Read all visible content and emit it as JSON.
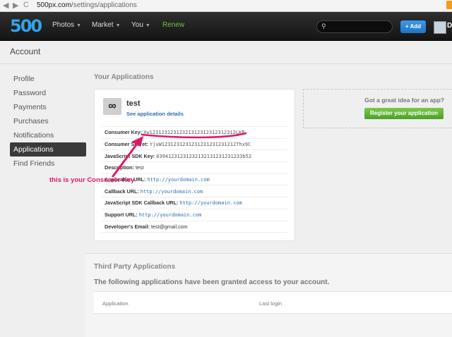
{
  "browser": {
    "url_host": "500px.com",
    "url_path": "/settings/applications",
    "back": "◀",
    "forward": "▶",
    "reload": "C"
  },
  "topnav": {
    "logo": "500",
    "items": [
      {
        "label": "Photos",
        "caret": "▼"
      },
      {
        "label": "Market",
        "caret": "▼"
      },
      {
        "label": "You",
        "caret": "▼"
      }
    ],
    "renew": "Renew",
    "search_placeholder": "",
    "add_label": "+ Add",
    "user_initial": "D"
  },
  "page_title": "Account",
  "sidebar": {
    "items": [
      {
        "label": "Profile"
      },
      {
        "label": "Password"
      },
      {
        "label": "Payments"
      },
      {
        "label": "Purchases"
      },
      {
        "label": "Notifications"
      },
      {
        "label": "Applications",
        "active": true
      },
      {
        "label": "Find Friends"
      }
    ]
  },
  "your_apps": {
    "title": "Your Applications",
    "app": {
      "icon": "∞",
      "name": "test",
      "details_link": "See application details",
      "rows": [
        {
          "label": "Consumer Key:",
          "value": "Xw12312312312321312312312312312LKR",
          "kind": "mono"
        },
        {
          "label": "Consumer Secret:",
          "value": "YjuW1231231231231231231231212Thx9C",
          "kind": "mono"
        },
        {
          "label": "JavaScript SDK Key:",
          "value": "83941231231232132131231231233b52",
          "kind": "mono"
        },
        {
          "label": "Description:",
          "value": "test",
          "kind": "plain"
        },
        {
          "label": "Application URL:",
          "value": "http://yourdomain.com",
          "kind": "link"
        },
        {
          "label": "Callback URL:",
          "value": "http://yourdomain.com",
          "kind": "link"
        },
        {
          "label": "JavaScript SDK Callback URL:",
          "value": "http://yourdomain.com",
          "kind": "link"
        },
        {
          "label": "Support URL:",
          "value": "http://yourdomain.com",
          "kind": "link"
        },
        {
          "label": "Developer's Email:",
          "value": "test@gmail.com",
          "kind": "plain"
        }
      ]
    }
  },
  "idea": {
    "text": "Got a great idea for an app?",
    "button": "Register your application"
  },
  "annotation": {
    "text": "this is your Consumer Key",
    "color": "#e0196a"
  },
  "third_party": {
    "title": "Third Party Applications",
    "description": "The following applications have been granted access to your account.",
    "columns": [
      "Application",
      "Last login"
    ]
  }
}
